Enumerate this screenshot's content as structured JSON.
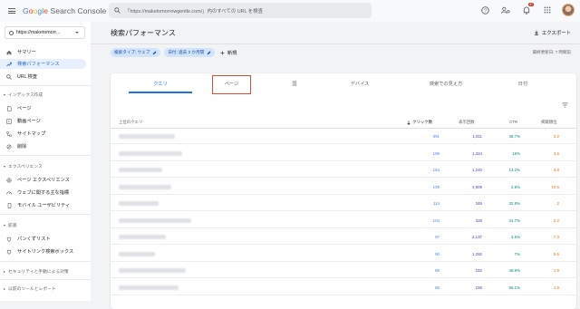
{
  "app": {
    "logo_google": "Google",
    "logo_product": "Search Console",
    "search_placeholder": "「https://maketomorrowgentle.com/」内のすべての URL を検査",
    "notification_count": "47"
  },
  "sidebar": {
    "property": "https://maketomorr...",
    "items_top": [
      {
        "label": "サマリー",
        "icon": "home-icon"
      },
      {
        "label": "検索パフォーマンス",
        "icon": "trending-up-icon",
        "active": true
      },
      {
        "label": "URL 検査",
        "icon": "search-icon"
      }
    ],
    "section_index": "インデックス作成",
    "items_index": [
      {
        "label": "ページ",
        "icon": "page-icon"
      },
      {
        "label": "動画ページ",
        "icon": "video-page-icon"
      },
      {
        "label": "サイトマップ",
        "icon": "sitemap-icon"
      },
      {
        "label": "削除",
        "icon": "remove-icon"
      }
    ],
    "section_experience": "エクスペリエンス",
    "items_experience": [
      {
        "label": "ページ エクスペリエンス",
        "icon": "gear-icon"
      },
      {
        "label": "ウェブに関する主な指標",
        "icon": "speed-icon"
      },
      {
        "label": "モバイル ユーザビリティ",
        "icon": "mobile-icon"
      }
    ],
    "section_enhancements": "拡張",
    "items_enhancements": [
      {
        "label": "パンくずリスト",
        "icon": "breadcrumb-icon"
      },
      {
        "label": "サイトリンク検索ボックス",
        "icon": "sitelinks-icon"
      }
    ],
    "section_security": "セキュリティと手動による対策",
    "section_legacy": "以前のツールとレポート"
  },
  "main": {
    "title": "検索パフォーマンス",
    "export_label": "エクスポート",
    "chips": [
      "検索タイプ: ウェブ",
      "日付: 過去 3 か月間"
    ],
    "new_label": "新規",
    "last_updated": "最終更新日: 7 時間前",
    "tabs": [
      "クエリ",
      "ページ",
      "国",
      "デバイス",
      "検索での見え方",
      "日付"
    ],
    "active_tab": 0,
    "columns": {
      "query": "上位のクエリ",
      "clicks": "クリック数",
      "impressions": "表示回数",
      "ctr": "CTR",
      "position": "掲載順位"
    },
    "rows": [
      {
        "clicks": "391",
        "impressions": "1,011",
        "ctr": "38.7%",
        "position": "3.2"
      },
      {
        "clicks": "199",
        "impressions": "1,324",
        "ctr": "15%",
        "position": "3.6"
      },
      {
        "clicks": "164",
        "impressions": "1,240",
        "ctr": "13.2%",
        "position": "3.8"
      },
      {
        "clicks": "139",
        "impressions": "4,909",
        "ctr": "2.8%",
        "position": "10.5"
      },
      {
        "clicks": "114",
        "impressions": "346",
        "ctr": "32.9%",
        "position": "2"
      },
      {
        "clicks": "104",
        "impressions": "328",
        "ctr": "31.7%",
        "position": "2.2"
      },
      {
        "clicks": "97",
        "impressions": "2,137",
        "ctr": "4.5%",
        "position": "7.3"
      },
      {
        "clicks": "90",
        "impressions": "1,292",
        "ctr": "7%",
        "position": "5.5"
      },
      {
        "clicks": "89",
        "impressions": "182",
        "ctr": "48.9%",
        "position": "1.9"
      },
      {
        "clicks": "86",
        "impressions": "156",
        "ctr": "55.1%",
        "position": "1.9"
      }
    ]
  },
  "colors": {
    "clicks": "#4285f4",
    "impressions": "#5e35b1",
    "ctr": "#00897b",
    "position": "#e8710a",
    "accent": "#1a73e8"
  }
}
